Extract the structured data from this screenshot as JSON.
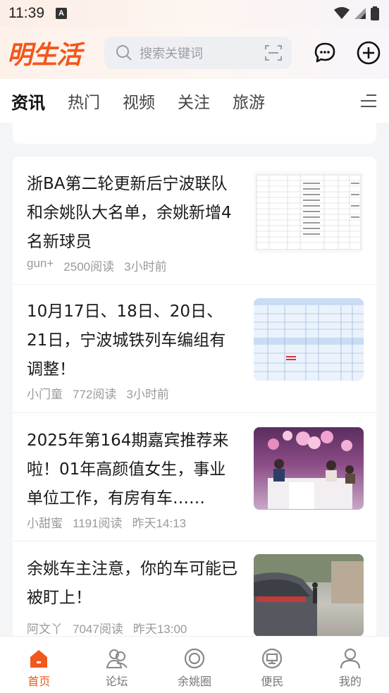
{
  "status_bar": {
    "time": "11:39",
    "notif_icon_letter": "A"
  },
  "header": {
    "logo": "明生活",
    "search_placeholder": "搜索关键词",
    "accent_color": "#f2571c"
  },
  "tabs": [
    {
      "label": "资讯",
      "active": true
    },
    {
      "label": "热门",
      "active": false
    },
    {
      "label": "视频",
      "active": false
    },
    {
      "label": "关注",
      "active": false
    },
    {
      "label": "旅游",
      "active": false
    }
  ],
  "feed": [
    {
      "title": "浙BA第二轮更新后宁波联队和余姚队大名单，余姚新增4名新球员",
      "author": "gun+",
      "reads": "2500阅读",
      "time": "3小时前"
    },
    {
      "title": "10月17日、18日、20日、21日，宁波城铁列车编组有调整！",
      "author": "小门童",
      "reads": "772阅读",
      "time": "3小时前"
    },
    {
      "title": "2025年第164期嘉宾推荐来啦！01年高颜值女生，事业单位工作，有房有车……",
      "author": "小甜蜜",
      "reads": "1191阅读",
      "time": "昨天14:13"
    },
    {
      "title": "余姚车主注意，你的车可能已被盯上！",
      "author": "阿文丫",
      "reads": "7047阅读",
      "time": "昨天13:00"
    }
  ],
  "bottom_nav": [
    {
      "label": "首页",
      "icon": "home-icon",
      "active": true
    },
    {
      "label": "论坛",
      "icon": "forum-icon",
      "active": false
    },
    {
      "label": "余姚圈",
      "icon": "circle-icon",
      "active": false
    },
    {
      "label": "便民",
      "icon": "service-icon",
      "active": false
    },
    {
      "label": "我的",
      "icon": "profile-icon",
      "active": false
    }
  ]
}
